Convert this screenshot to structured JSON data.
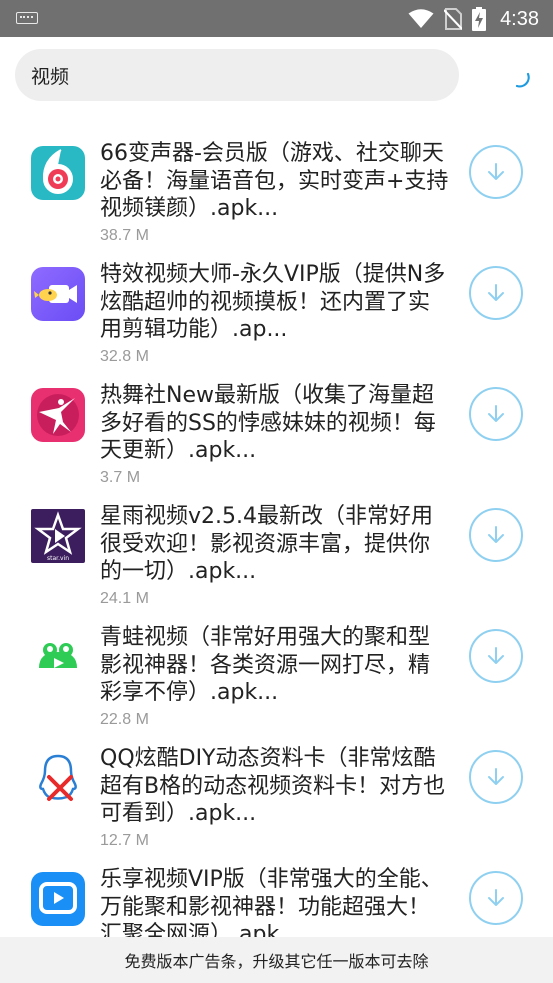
{
  "status_bar": {
    "time": "4:38",
    "icons": [
      "keyboard-icon",
      "wifi-icon",
      "no-sim-icon",
      "battery-charging-icon"
    ]
  },
  "search": {
    "value": "视频",
    "placeholder": ""
  },
  "accent_color": "#1e9be0",
  "apps": [
    {
      "icon": "app-icon-66-voice-changer",
      "title_lines": [
        "66变声器-会员版（游戏、社交聊天",
        "必备！海量语音包，实时变声+支持",
        "视频镁颜）.apk..."
      ],
      "size": "38.7 M"
    },
    {
      "icon": "app-icon-effects-video-master",
      "title_lines": [
        "特效视频大师-永久VIP版（提供N多",
        "炫酷超帅的视频摸板！还内置了实",
        "用剪辑功能）.ap..."
      ],
      "size": "32.8 M"
    },
    {
      "icon": "app-icon-dance-club",
      "title_lines": [
        "热舞社New最新版（收集了海量超",
        "多好看的SS的悖感妹妹的视频！每",
        "天更新）.apk..."
      ],
      "size": "3.7 M"
    },
    {
      "icon": "app-icon-star-rain-video",
      "title_lines": [
        "星雨视频v2.5.4最新改（非常好用",
        "很受欢迎！影视资源丰富，提供你",
        "的一切）.apk..."
      ],
      "size": "24.1 M"
    },
    {
      "icon": "app-icon-frog-video",
      "title_lines": [
        "青蛙视频（非常好用强大的聚和型",
        "影视神器！各类资源一网打尽，精",
        "彩享不停）.apk..."
      ],
      "size": "22.8 M"
    },
    {
      "icon": "app-icon-qq-diy-card",
      "title_lines": [
        "QQ炫酷DIY动态资料卡（非常炫酷",
        "超有B格的动态视频资料卡！对方也",
        "可看到）.apk..."
      ],
      "size": "12.7 M"
    },
    {
      "icon": "app-icon-leshare-video",
      "title_lines": [
        "乐享视频VIP版（非常强大的全能、",
        "万能聚和影视神器！功能超强大！",
        "汇聚全网源）.apk..."
      ],
      "size": ""
    }
  ],
  "ad_banner": {
    "text": "免费版本广告条，升级其它任一版本可去除"
  }
}
